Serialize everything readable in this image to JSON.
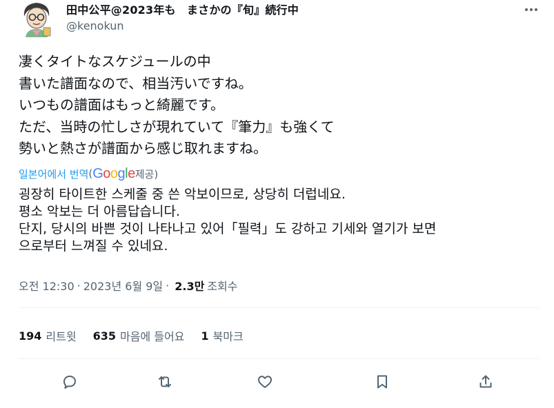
{
  "author": {
    "display_name": "田中公平@2023年も　まさかの『旬』続行中",
    "handle": "@kenokun"
  },
  "tweet": {
    "lines": [
      "凄くタイトなスケジュールの中",
      "書いた譜面なので、相当汚いですね。",
      "いつもの譜面はもっと綺麗です。",
      "ただ、当時の忙しさが現れていて『筆力』も強くて",
      "勢いと熱さが譜面から感じ取れますね。"
    ]
  },
  "translation": {
    "link_label": "일본어에서 번역",
    "open_paren": "(",
    "google": [
      "G",
      "o",
      "o",
      "g",
      "l",
      "e"
    ],
    "provided": " 제공)",
    "lines": [
      "굉장히 타이트한 스케줄 중 쓴 악보이므로, 상당히 더럽네요.",
      "평소 악보는 더 아름답습니다.",
      "단지, 당시의 바쁜 것이 나타나고 있어「필력」도 강하고 기세와 열기가 보면",
      "으로부터 느껴질 수 있네요."
    ]
  },
  "meta": {
    "time": "오전 12:30",
    "separator": "·",
    "date": "2023년 6월 9일",
    "views_count": "2.3만",
    "views_label": "조회수"
  },
  "stats": {
    "retweets_count": "194",
    "retweets_label": "리트윗",
    "likes_count": "635",
    "likes_label": "마음에 들어요",
    "bookmarks_count": "1",
    "bookmarks_label": "북마크"
  },
  "actions": [
    "reply-icon",
    "retweet-icon",
    "like-icon",
    "bookmark-icon",
    "share-icon"
  ],
  "colors": {
    "text": "#0f1419",
    "muted": "#536471",
    "link": "#1d9bf0",
    "divider": "#eff3f4"
  }
}
